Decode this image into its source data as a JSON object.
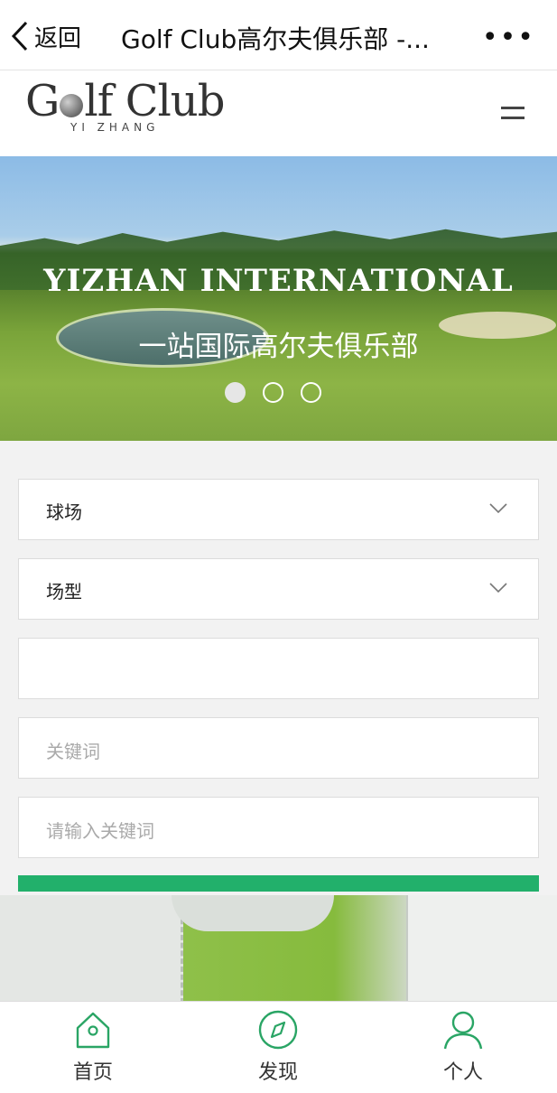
{
  "nav": {
    "back_label": "返回",
    "title": "Golf Club高尔夫俱乐部 -...",
    "more": "•••"
  },
  "logo": {
    "text_pre": "G",
    "text_post": "lf Club",
    "sub": "YI ZHANG"
  },
  "banner": {
    "title": "YIZHAN INTERNATIONAL",
    "subtitle": "一站国际高尔夫俱乐部",
    "slide_count": 3,
    "active_slide": 1
  },
  "form": {
    "course_select": {
      "value": "球场"
    },
    "type_select": {
      "value": "场型"
    },
    "empty_field": {
      "value": ""
    },
    "keyword_field": {
      "placeholder": "关键词"
    },
    "search_field": {
      "placeholder": "请输入关键词"
    }
  },
  "tabbar": {
    "items": [
      {
        "label": "首页"
      },
      {
        "label": "发现"
      },
      {
        "label": "个人"
      }
    ]
  },
  "colors": {
    "accent": "#22b06b",
    "icon_green": "#2aa565"
  }
}
